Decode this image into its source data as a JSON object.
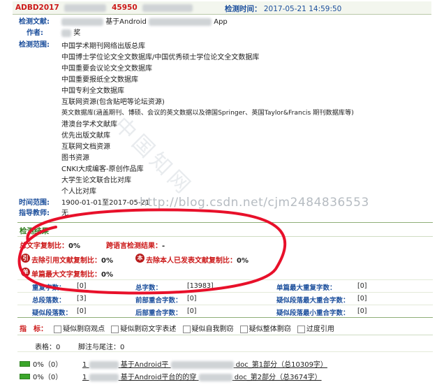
{
  "header": {
    "report_id_prefix": "ADBD2017",
    "report_id_mid": "45950",
    "check_time_label": "检测时间：",
    "check_time_value": "2017-05-21 14:59:50"
  },
  "meta": {
    "doc_label": "检测文献:",
    "doc_title_visible": "基于Android",
    "doc_title_suffix": "App",
    "author_label": "作者:",
    "author_visible": "奖",
    "scope_label": "检测范围:",
    "scope_items": [
      "中国学术期刊网络出版总库",
      "中国博士学位论文全文数据库/中国优秀硕士学位论文全文数据库",
      "中国重要会议论文全文数据库",
      "中国重要报纸全文数据库",
      "中国专利全文数据库",
      "互联网资源(包含贴吧等论坛资源)",
      "英文数据库(涵盖期刊、博硕、会议的英文数据以及德国Springer、英国Taylor&Francis 期刊数据库等)",
      "港澳台学术文献库",
      "优先出版文献库",
      "互联网文档资源",
      "图书资源",
      "CNKI大成编客-原创作品库",
      "大学生论文联合比对库",
      "个人比对库"
    ],
    "time_range_label": "时间范围:",
    "time_range_value": "1900-01-01至2017-05-21",
    "advisor_label": "指导教师:",
    "advisor_value": "无"
  },
  "result": {
    "section_title": "检测结果",
    "total_copy_label": "总文字复制比：",
    "total_copy_value": "0%",
    "cross_lang_label": "跨语言检测结果：",
    "cross_lang_value": "-",
    "excl_cite_badge": "引",
    "excl_cite_label": "去除引用文献复制比：",
    "excl_cite_value": "0%",
    "excl_self_badge": "本",
    "excl_self_label": "去除本人已发表文献复制比：",
    "excl_self_value": "0%",
    "single_max_badge": "单",
    "single_max_label": "单篇最大文字复制比：",
    "single_max_value": "0%",
    "stats": {
      "dup_chars_label": "重复字数：",
      "dup_chars_value": "[0]",
      "total_chars_label": "总字数：",
      "total_chars_value": "[13983]",
      "single_max_dup_label": "单篇最大重复字数：",
      "single_max_dup_value": "[0]",
      "total_para_label": "总段落数：",
      "total_para_value": "[3]",
      "front_overlap_label": "前部重合字数：",
      "front_overlap_value": "[0]",
      "susp_max_overlap_label": "疑似段落最大重合字数：",
      "susp_max_overlap_value": "[0]",
      "susp_para_label": "疑似段落数：",
      "susp_para_value": "[0]",
      "back_overlap_label": "后部重合字数：",
      "back_overlap_value": "[0]",
      "susp_min_overlap_label": "疑似段落最小重合字数：",
      "susp_min_overlap_value": "[0]"
    }
  },
  "indicators": {
    "label": "指　标：",
    "options": [
      "疑似剽窃观点",
      "疑似剽窃文字表述",
      "疑似自我剽窃",
      "疑似整体剽窃",
      "过度引用"
    ]
  },
  "counts": {
    "table_label": "表格：",
    "table_value": "0",
    "footnote_label": "脚注与尾注：",
    "footnote_value": "0"
  },
  "parts": [
    {
      "progress": 0,
      "pct_text": "0%（0）",
      "index_text": "1",
      "title_visible": "基于Android平",
      "suffix_text": "doc_第1部分（总10309字）"
    },
    {
      "progress": 0,
      "pct_text": "0%（0）",
      "index_text": "1",
      "title_visible": "基于Android平台的的穿",
      "suffix_text": "doc_第2部分（总3674字）"
    }
  ],
  "watermark": {
    "url_text": "http://blog.csdn.net/cjm2484836553",
    "cn_text": "中国知网"
  }
}
